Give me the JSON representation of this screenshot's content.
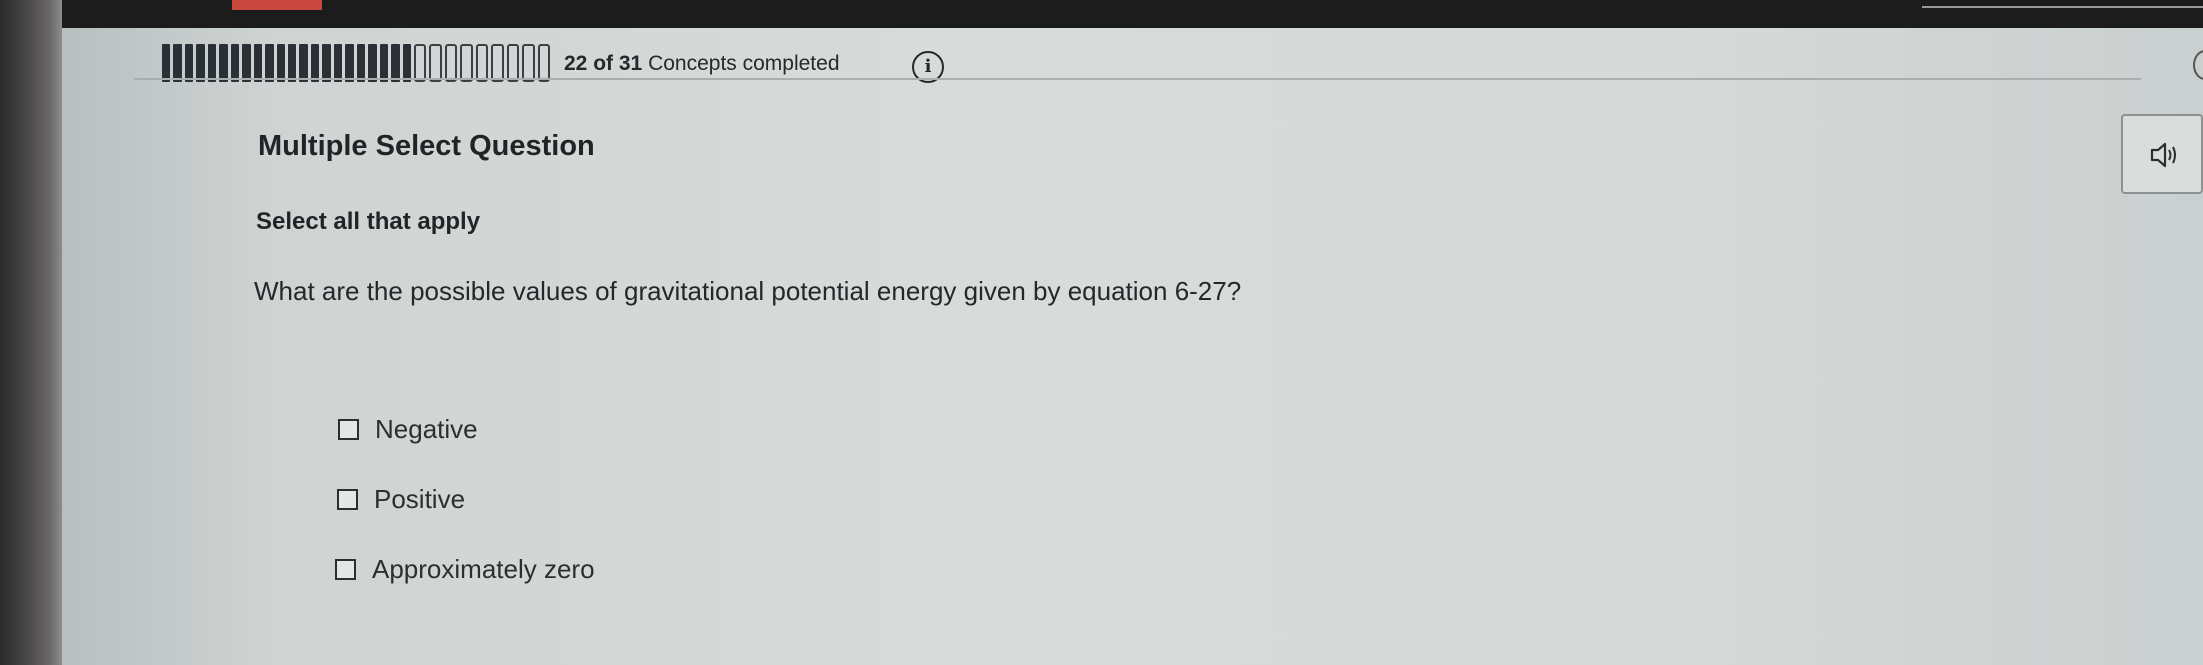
{
  "progress": {
    "text_count": "22 of 31",
    "text_suffix": "Concepts completed",
    "completed": 22,
    "total": 31
  },
  "question": {
    "title": "Multiple Select Question",
    "instruction": "Select all that apply",
    "prompt": "What are the possible values of gravitational potential energy given by equation 6-27?",
    "options": [
      {
        "label": "Negative",
        "checked": false
      },
      {
        "label": "Positive",
        "checked": false
      },
      {
        "label": "Approximately zero",
        "checked": false
      }
    ]
  },
  "icons": {
    "info": "info-icon",
    "audio": "speaker-icon"
  },
  "colors": {
    "accent_dark": "#25292c",
    "background": "#d6dad8"
  }
}
